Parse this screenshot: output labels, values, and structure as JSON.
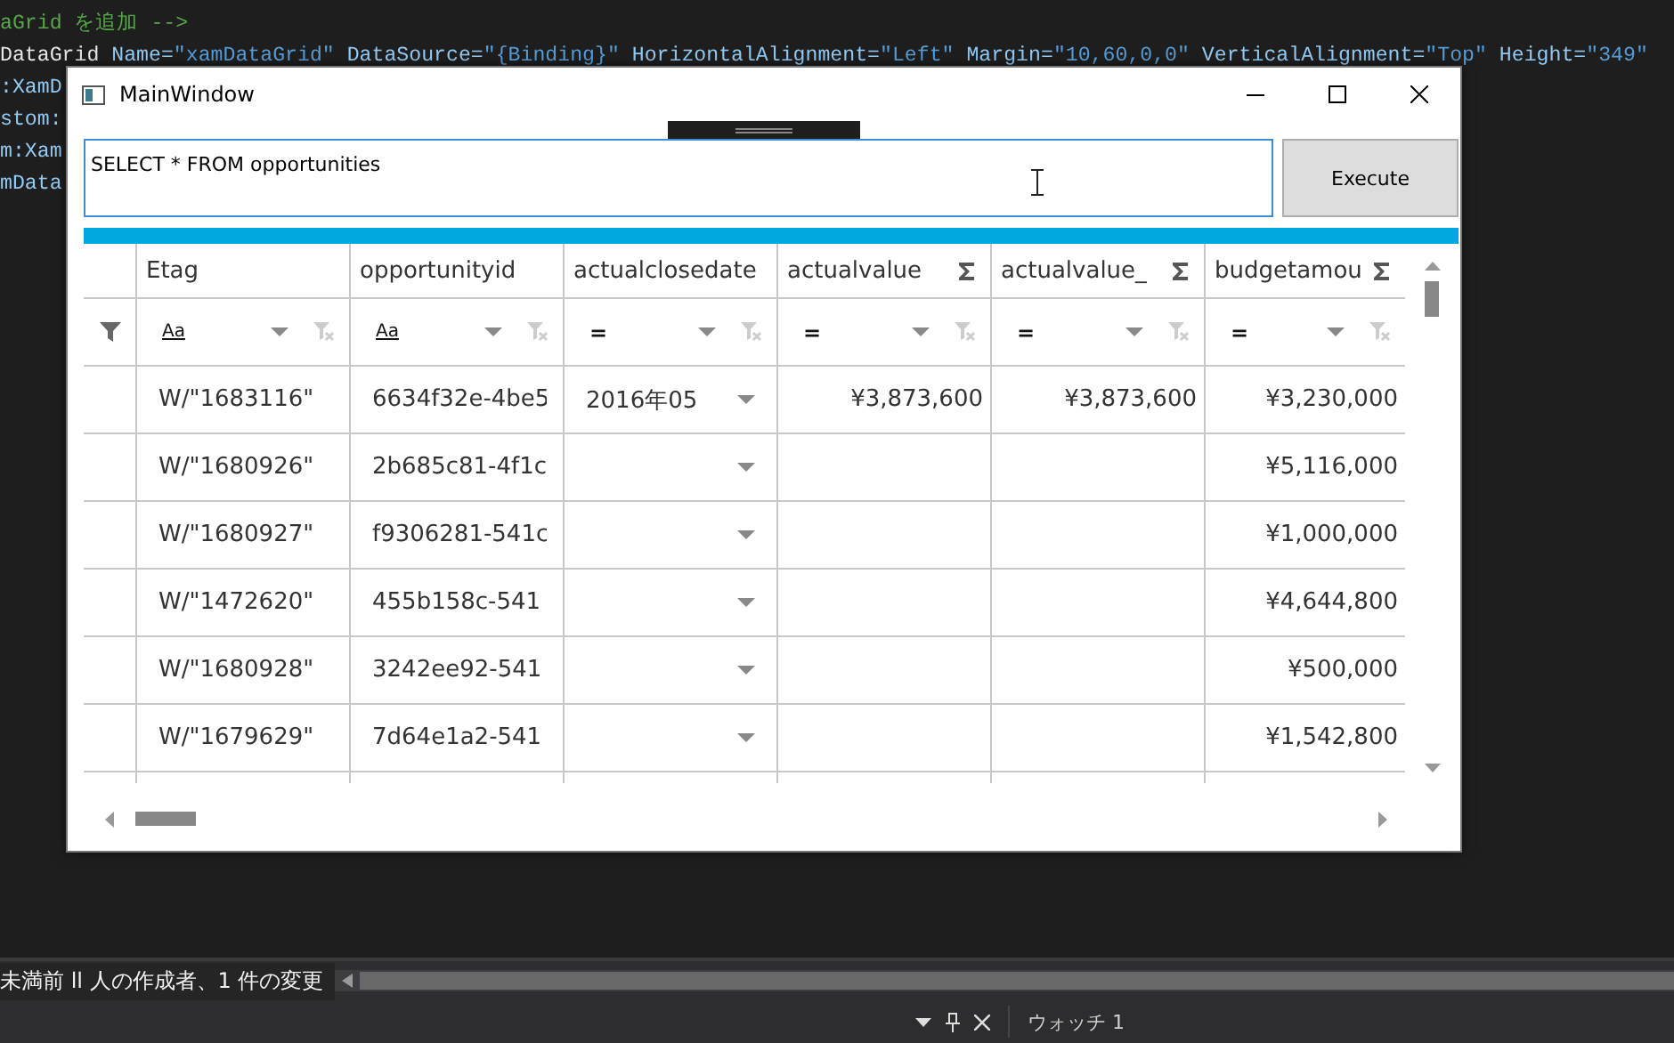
{
  "editor": {
    "lines": [
      {
        "tokens": [
          {
            "kind": "comment",
            "text": "aGrid を追加 -->"
          }
        ]
      },
      {
        "tokens": [
          {
            "kind": "element",
            "text": "DataGrid"
          },
          {
            "kind": "attr",
            "text": " Name="
          },
          {
            "kind": "value",
            "text": "\"xamDataGrid\""
          },
          {
            "kind": "attr",
            "text": " DataSource="
          },
          {
            "kind": "value",
            "text": "\"{Binding}\""
          },
          {
            "kind": "attr",
            "text": " HorizontalAlignment="
          },
          {
            "kind": "value",
            "text": "\"Left\""
          },
          {
            "kind": "attr",
            "text": " Margin="
          },
          {
            "kind": "value",
            "text": "\"10,60,0,0\""
          },
          {
            "kind": "attr",
            "text": " VerticalAlignment="
          },
          {
            "kind": "value",
            "text": "\"Top\""
          },
          {
            "kind": "attr",
            "text": " Height="
          },
          {
            "kind": "value",
            "text": "\"349\""
          }
        ]
      },
      {
        "tokens": [
          {
            "kind": "attr",
            "text": ":XamD"
          }
        ]
      },
      {
        "tokens": [
          {
            "kind": "attr",
            "text": "stom:"
          }
        ]
      },
      {
        "tokens": [
          {
            "kind": "attr",
            "text": "m:Xam"
          }
        ]
      },
      {
        "tokens": [
          {
            "kind": "attr",
            "text": "mData"
          }
        ]
      }
    ]
  },
  "window": {
    "title": "MainWindow",
    "query": {
      "value": "SELECT * FROM opportunities"
    },
    "execute_button": "Execute",
    "progress": {
      "level": 1
    },
    "grid": {
      "columns": [
        {
          "header": "Etag",
          "kind": "text",
          "summary": false,
          "filter": "Aa"
        },
        {
          "header": "opportunityid",
          "kind": "text",
          "summary": false,
          "filter": "Aa"
        },
        {
          "header": "actualclosedate",
          "kind": "date",
          "summary": false,
          "filter": "="
        },
        {
          "header": "actualvalue",
          "kind": "currency",
          "summary": true,
          "filter": "="
        },
        {
          "header": "actualvalue_",
          "kind": "currency",
          "summary": true,
          "filter": "="
        },
        {
          "header": "budgetamou",
          "kind": "currency",
          "summary": true,
          "filter": "="
        }
      ],
      "rows": [
        {
          "cells": [
            "W/\"1683116\"",
            "6634f32e-4be5",
            "2016年05",
            "¥3,873,600",
            "¥3,873,600",
            "¥3,230,000"
          ]
        },
        {
          "cells": [
            "W/\"1680926\"",
            "2b685c81-4f1c",
            null,
            null,
            null,
            "¥5,116,000"
          ]
        },
        {
          "cells": [
            "W/\"1680927\"",
            "f9306281-541c",
            null,
            null,
            null,
            "¥1,000,000"
          ]
        },
        {
          "cells": [
            "W/\"1472620\"",
            "455b158c-541",
            null,
            null,
            null,
            "¥4,644,800"
          ]
        },
        {
          "cells": [
            "W/\"1680928\"",
            "3242ee92-541",
            null,
            null,
            null,
            "¥500,000"
          ]
        },
        {
          "cells": [
            "W/\"1679629\"",
            "7d64e1a2-541",
            null,
            null,
            null,
            "¥1,542,800"
          ]
        }
      ]
    }
  },
  "status_bar": {
    "text": "未満前 ll 人の作成者、1 件の変更"
  },
  "bottom_panel": {
    "title": "ウォッチ 1"
  }
}
